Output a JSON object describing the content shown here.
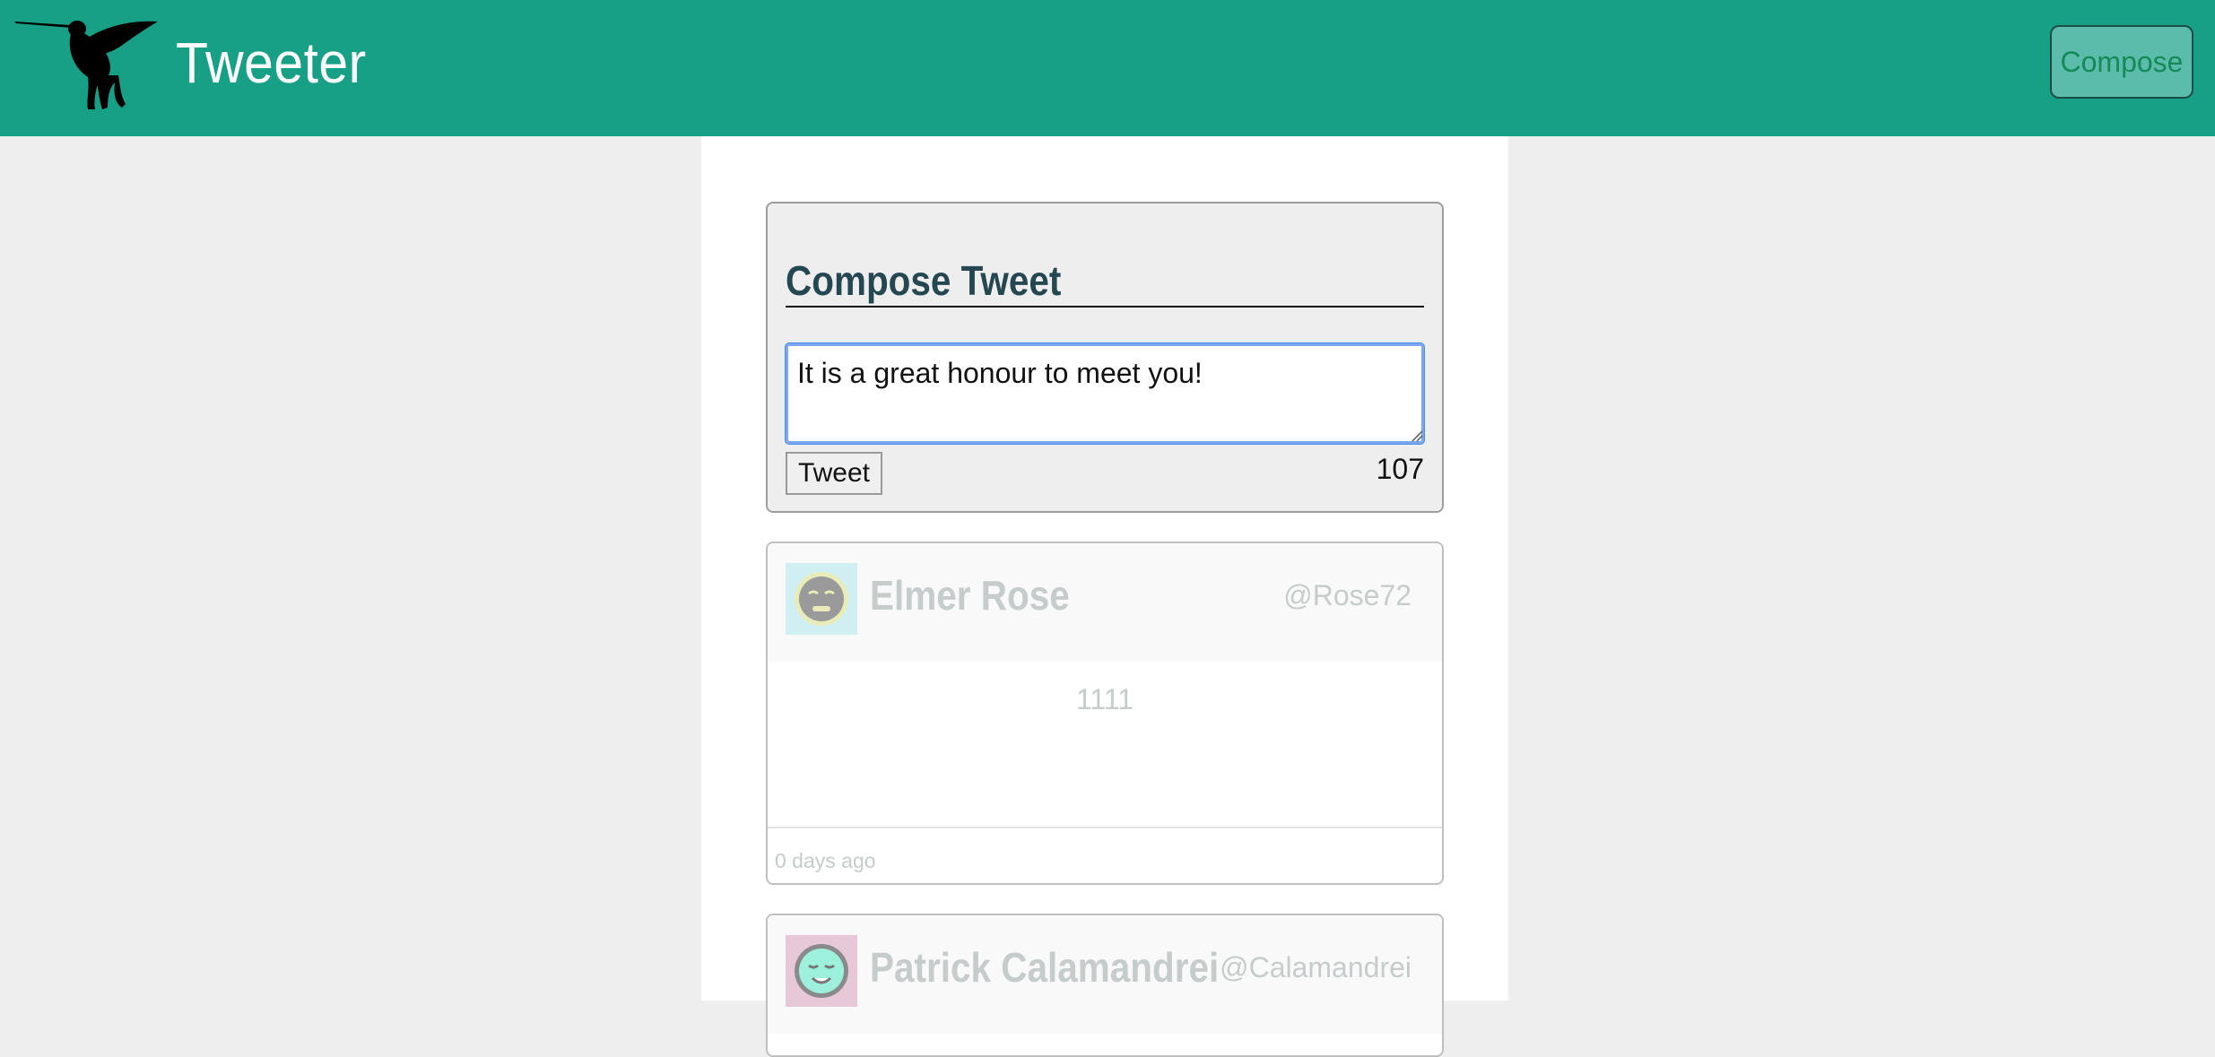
{
  "header": {
    "app_title": "Tweeter",
    "compose_label": "Compose",
    "logo_icon": "hummingbird-icon",
    "background_color": "#18a087"
  },
  "compose": {
    "heading": "Compose Tweet",
    "textarea_value": "It is a great honour to meet you!",
    "tweet_button_label": "Tweet",
    "char_counter": "107"
  },
  "tweets": [
    {
      "author_name": "Elmer Rose",
      "author_handle": "@Rose72",
      "content": "1111",
      "time_ago": "0 days ago",
      "avatar_icon": "face-avatar-icon"
    },
    {
      "author_name": "Patrick Calamandrei",
      "author_handle": "@Calamandrei",
      "avatar_icon": "face-avatar-icon"
    }
  ],
  "colors": {
    "accent": "#18a087",
    "heading": "#244751",
    "faded_text": "#c6cbcc",
    "focus_ring": "#4c8be8"
  }
}
